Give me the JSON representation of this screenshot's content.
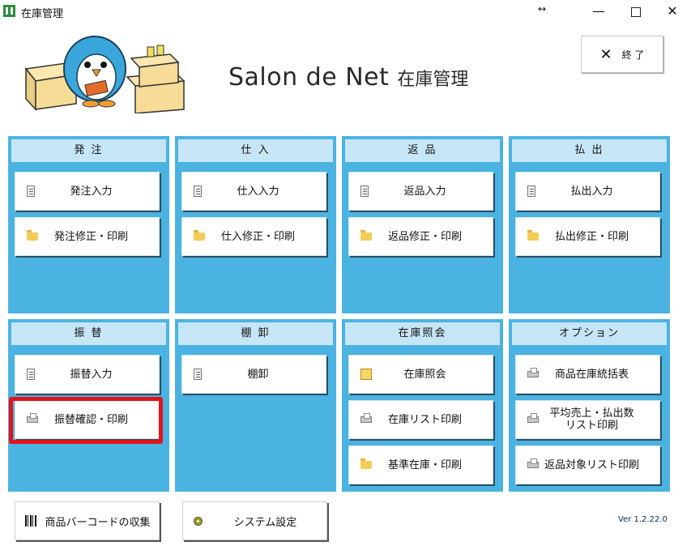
{
  "window": {
    "title": "在庫管理",
    "resize_glyph": "↔",
    "minimize_glyph": "—",
    "close_glyph": "✕"
  },
  "header": {
    "brand": "Salon de Net",
    "brand_ja": "在庫管理",
    "exit_label": "終 了",
    "exit_glyph": "✕"
  },
  "panels": [
    {
      "title": "発 注",
      "items": [
        {
          "label": "発注入力",
          "icon": "document-icon"
        },
        {
          "label": "発注修正・印刷",
          "icon": "folder-icon"
        }
      ]
    },
    {
      "title": "仕 入",
      "items": [
        {
          "label": "仕入入力",
          "icon": "document-icon"
        },
        {
          "label": "仕入修正・印刷",
          "icon": "folder-icon"
        }
      ]
    },
    {
      "title": "返 品",
      "items": [
        {
          "label": "返品入力",
          "icon": "document-icon"
        },
        {
          "label": "返品修正・印刷",
          "icon": "folder-icon"
        }
      ]
    },
    {
      "title": "払 出",
      "items": [
        {
          "label": "払出入力",
          "icon": "document-icon"
        },
        {
          "label": "払出修正・印刷",
          "icon": "folder-icon"
        }
      ]
    },
    {
      "title": "振 替",
      "items": [
        {
          "label": "振替入力",
          "icon": "document-icon"
        },
        {
          "label": "振替確認・印刷",
          "icon": "printer-icon"
        }
      ]
    },
    {
      "title": "棚 卸",
      "items": [
        {
          "label": "棚卸",
          "icon": "document-icon"
        }
      ]
    },
    {
      "title": "在庫照会",
      "items": [
        {
          "label": "在庫照会",
          "icon": "note-icon"
        },
        {
          "label": "在庫リスト印刷",
          "icon": "printer-icon"
        },
        {
          "label": "基準在庫・印刷",
          "icon": "folder-icon"
        }
      ]
    },
    {
      "title": "オプション",
      "items": [
        {
          "label": "商品在庫統括表",
          "icon": "printer-icon"
        },
        {
          "label": "平均売上・払出数\nリスト印刷",
          "icon": "printer-icon"
        },
        {
          "label": "返品対象リスト印刷",
          "icon": "printer-icon"
        }
      ]
    }
  ],
  "bottom": {
    "barcode_label": "商品バーコードの収集",
    "settings_label": "システム設定",
    "version": "Ver 1.2.22.0"
  },
  "colors": {
    "panel_bg": "#4bb3e1",
    "panel_title_bg": "#c6e6f7",
    "highlight": "#e5121a"
  }
}
